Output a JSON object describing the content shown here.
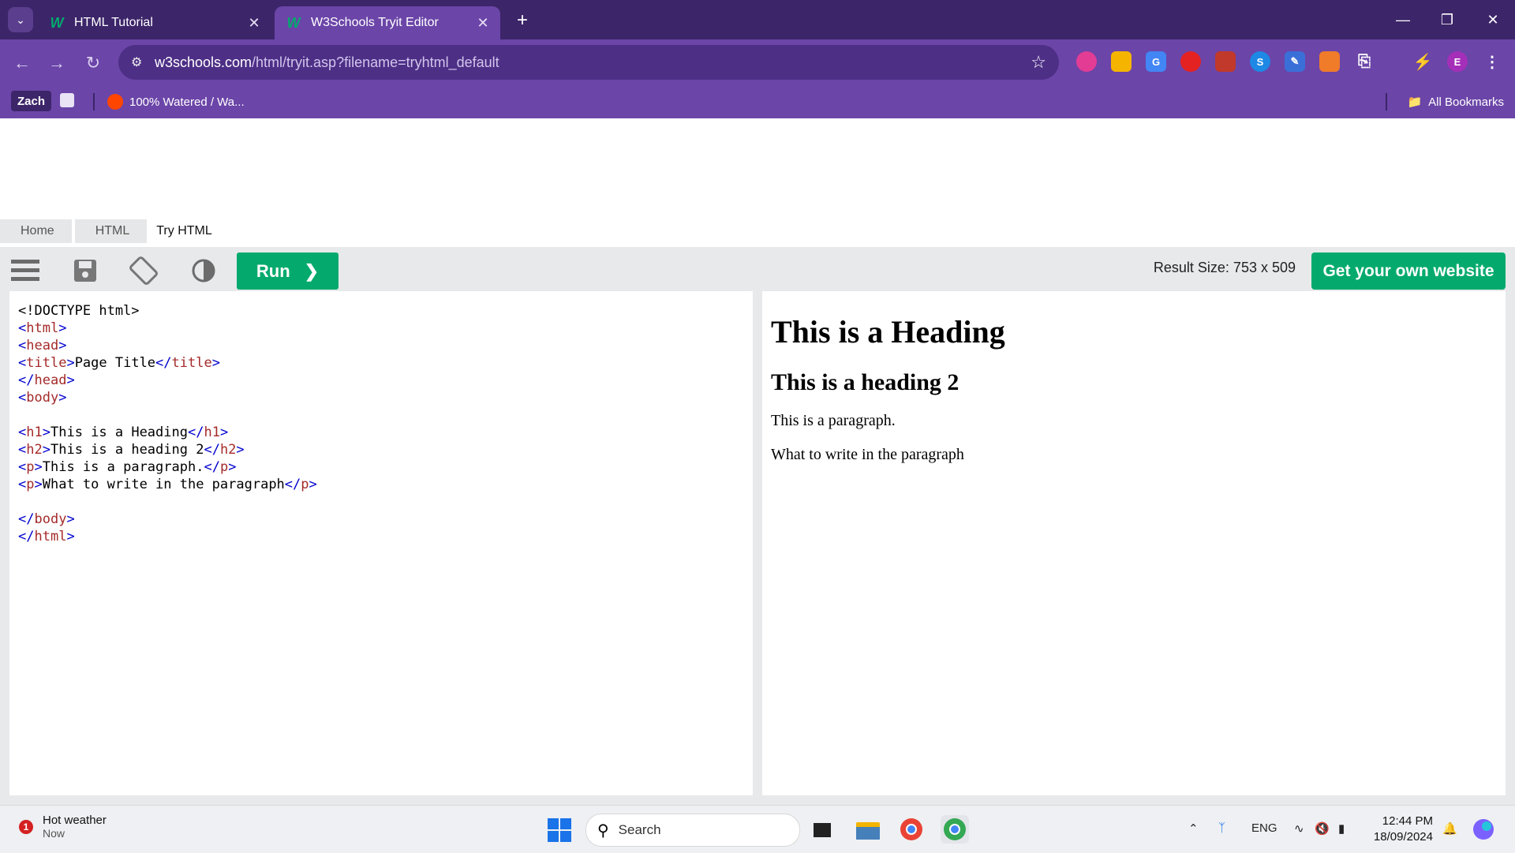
{
  "browser": {
    "tabs": [
      {
        "title": "HTML Tutorial",
        "favicon": "w3schools-icon"
      },
      {
        "title": "W3Schools Tryit Editor",
        "favicon": "w3schools-icon"
      }
    ],
    "url_host": "w3schools.com",
    "url_path": "/html/tryit.asp?filename=tryhtml_default",
    "bookmarks": {
      "profile_label": "Zach",
      "item_label": "100% Watered / Wa...",
      "all_label": "All Bookmarks"
    },
    "profile_initial": "E"
  },
  "breadcrumb": [
    "Home",
    "HTML",
    "Try HTML"
  ],
  "toolbar": {
    "run_label": "Run",
    "result_size": "Result Size: 753 x 509",
    "get_site_label": "Get your own website"
  },
  "editor": {
    "lines": [
      "<!DOCTYPE html>",
      "<html>",
      "<head>",
      "<title>Page Title</title>",
      "</head>",
      "<body>",
      "",
      "<h1>This is a Heading</h1>",
      "<h2>This is a heading 2</h2>",
      "<p>This is a paragraph.</p>",
      "<p>What to write in the paragraph</p>",
      "",
      "</body>",
      "</html>"
    ]
  },
  "result": {
    "h1": "This is a Heading",
    "h2": "This is a heading 2",
    "p1": "This is a paragraph.",
    "p2": "What to write in the paragraph"
  },
  "taskbar": {
    "weather_title": "Hot weather",
    "weather_sub": "Now",
    "weather_badge": "1",
    "search_label": "Search",
    "lang": "ENG",
    "time": "12:44 PM",
    "date": "18/09/2024"
  },
  "colors": {
    "tabbar": "#3c2569",
    "navbar": "#6b45a8",
    "accent_green": "#04aa6d"
  }
}
